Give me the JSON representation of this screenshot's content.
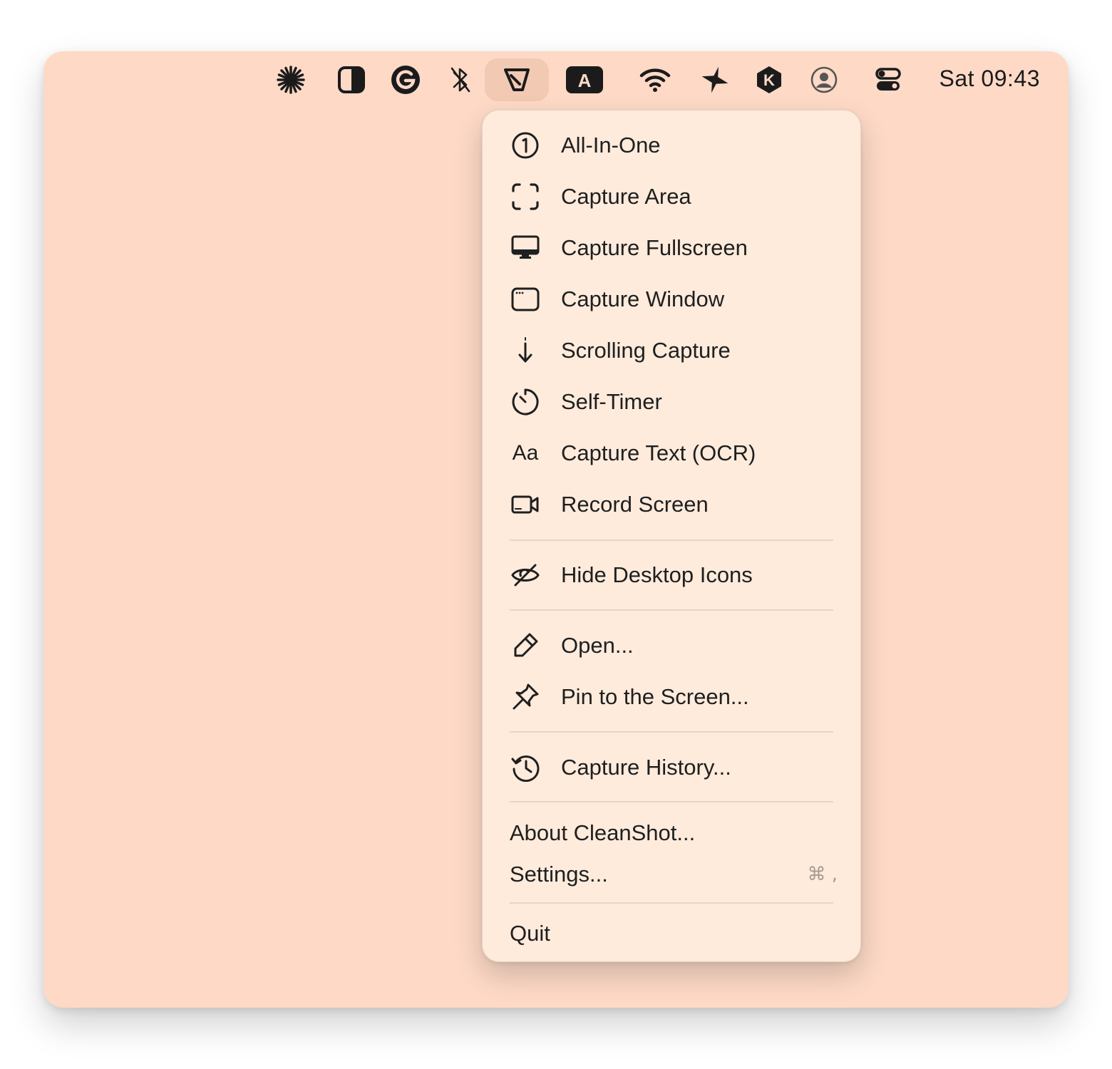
{
  "menubar": {
    "icons": [
      {
        "name": "asterisk-icon"
      },
      {
        "name": "contrast-icon"
      },
      {
        "name": "grammarly-icon"
      },
      {
        "name": "bluetooth-icon"
      },
      {
        "name": "cleanshot-icon"
      },
      {
        "name": "keyboard-input-a-icon",
        "label": "A"
      },
      {
        "name": "wifi-icon"
      },
      {
        "name": "airplane-icon"
      },
      {
        "name": "k-app-icon",
        "label": "K"
      },
      {
        "name": "user-account-icon"
      },
      {
        "name": "control-center-icon"
      }
    ],
    "clock": "Sat 09:43"
  },
  "menu": {
    "items": [
      {
        "label": "All-In-One",
        "icon": "one-circle-icon"
      },
      {
        "label": "Capture Area",
        "icon": "capture-area-icon"
      },
      {
        "label": "Capture Fullscreen",
        "icon": "display-icon"
      },
      {
        "label": "Capture Window",
        "icon": "window-icon"
      },
      {
        "label": "Scrolling Capture",
        "icon": "arrow-down-icon"
      },
      {
        "label": "Self-Timer",
        "icon": "timer-icon"
      },
      {
        "label": "Capture Text (OCR)",
        "icon": "text-aa-icon",
        "icon_text": "Aa"
      },
      {
        "label": "Record Screen",
        "icon": "video-camera-icon"
      },
      {
        "label": "Hide Desktop Icons",
        "icon": "eye-slash-icon"
      },
      {
        "label": "Open...",
        "icon": "pencil-icon"
      },
      {
        "label": "Pin to the Screen...",
        "icon": "pin-icon"
      },
      {
        "label": "Capture History...",
        "icon": "history-icon"
      },
      {
        "label": "About CleanShot..."
      },
      {
        "label": "Settings...",
        "shortcut": "⌘ ,"
      },
      {
        "label": "Quit"
      }
    ]
  },
  "colors": {
    "background": "#fdd9c6",
    "menu": "#feebdc",
    "active_icon_bg": "#f2c9b3",
    "text": "#1f1f1f",
    "shortcut_text": "#a59a92"
  }
}
